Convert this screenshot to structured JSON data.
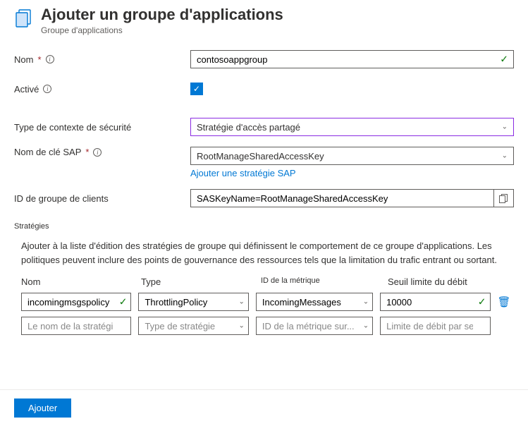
{
  "header": {
    "title": "Ajouter un groupe d'applications",
    "subtitle": "Groupe d'applications"
  },
  "form": {
    "name": {
      "label": "Nom",
      "value": "contosoappgroup"
    },
    "enabled": {
      "label": "Activé",
      "checked": true
    },
    "security_context": {
      "label": "Type de contexte de sécurité",
      "value": "Stratégie d'accès partagé"
    },
    "sap_key": {
      "label": "Nom de clé SAP",
      "value": "RootManageSharedAccessKey",
      "add_link": "Ajouter une stratégie SAP"
    },
    "client_group_id": {
      "label": "ID de groupe de clients",
      "value": "SASKeyName=RootManageSharedAccessKey"
    }
  },
  "policies": {
    "section_title": "Stratégies",
    "description": "Ajouter à la liste d'édition des stratégies de groupe qui définissent le comportement de ce groupe d'applications. Les politiques peuvent inclure des points de gouvernance des ressources tels que la limitation du trafic entrant ou sortant.",
    "columns": {
      "name": "Nom",
      "type": "Type",
      "metric": "ID de la métrique",
      "threshold": "Seuil limite du débit"
    },
    "rows": [
      {
        "name": "incomingmsgspolicy",
        "type": "ThrottlingPolicy",
        "metric": "IncomingMessages",
        "threshold": "10000",
        "valid": true
      }
    ],
    "placeholders": {
      "name": "Le nom de la stratégie",
      "type": "Type de stratégie",
      "metric": "ID de la métrique sur...",
      "threshold": "Limite de débit par seconde"
    }
  },
  "footer": {
    "submit": "Ajouter"
  }
}
